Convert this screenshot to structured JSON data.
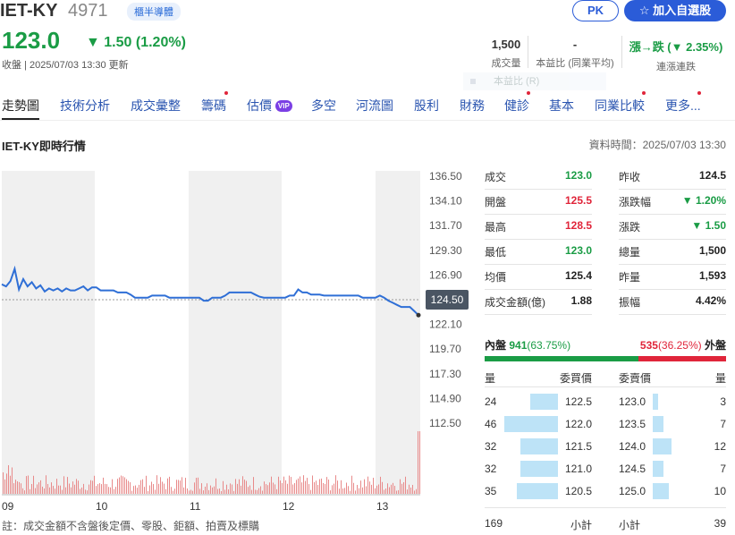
{
  "header": {
    "title": "IET-KY",
    "code": "4971",
    "tag": "櫃半導體",
    "pk_label": "PK",
    "add_label": "☆ 加入自選股"
  },
  "quote": {
    "price": "123.0",
    "change": "▼ 1.50 (1.20%)",
    "updated": "收盤 | 2025/07/03 13:30 更新"
  },
  "stats": {
    "volume_val": "1,500",
    "volume_lbl": "成交量",
    "pe_val": "-",
    "pe_lbl": "本益比 (同業平均)",
    "trend_val": "漲→跌 (▼ 2.35%)",
    "trend_lbl": "連漲連跌",
    "overlay": "本益比 (R)"
  },
  "tabs": [
    "走勢圖",
    "技術分析",
    "成交彙整",
    "籌碼",
    "估價",
    "多空",
    "河流圖",
    "股利",
    "財務",
    "健診",
    "基本",
    "同業比較",
    "更多..."
  ],
  "vip_label": "VIP",
  "section": {
    "title": "IET-KY即時行情",
    "data_time": "資料時間：2025/07/03 13:30"
  },
  "chart_data": {
    "type": "line",
    "yticks": [
      "136.50",
      "134.10",
      "131.70",
      "129.30",
      "126.90",
      "124.50",
      "122.10",
      "119.70",
      "117.30",
      "114.90",
      "112.50"
    ],
    "xticks": [
      "09",
      "10",
      "11",
      "12",
      "13"
    ],
    "current_label": "124.50",
    "ylim": [
      112.5,
      136.5
    ],
    "reference": 124.5,
    "series": [
      {
        "values": [
          126.0,
          125.8,
          126.3,
          127.5,
          125.5,
          126.5,
          125.8,
          126.2,
          125.6,
          125.9,
          125.3,
          125.6,
          125.4,
          125.6,
          125.3,
          125.6,
          125.4,
          125.4,
          125.6,
          125.8,
          125.4,
          125.7,
          125.7,
          125.4,
          125.4,
          125.4,
          125.4,
          125.2,
          125.2,
          125.2,
          125.0,
          124.7,
          124.7,
          124.7,
          124.7,
          124.9,
          124.9,
          124.9,
          124.9,
          124.7,
          124.7,
          124.7,
          124.7,
          124.7,
          124.7,
          124.7,
          124.7,
          124.4,
          124.4,
          124.7,
          124.7,
          124.7,
          124.9,
          125.2,
          125.2,
          125.2,
          125.2,
          125.2,
          125.2,
          125.0,
          124.8,
          124.7,
          124.7,
          124.7,
          124.7,
          124.7,
          124.7,
          124.9,
          124.9,
          125.5,
          125.2,
          125.2,
          125.0,
          125.0,
          125.0,
          124.9,
          124.9,
          124.9,
          124.9,
          124.9,
          124.9,
          124.9,
          124.9,
          124.9,
          124.7,
          124.7,
          124.7,
          124.7,
          124.9,
          124.7,
          124.4,
          124.2,
          124.0,
          123.8,
          123.8,
          123.8,
          123.4,
          123.0
        ]
      }
    ],
    "volume_note": "volume bars"
  },
  "quote_table": {
    "left": [
      {
        "label": "成交",
        "value": "123.0",
        "color": "green"
      },
      {
        "label": "開盤",
        "value": "125.5",
        "color": "red"
      },
      {
        "label": "最高",
        "value": "128.5",
        "color": "red"
      },
      {
        "label": "最低",
        "value": "123.0",
        "color": "green"
      },
      {
        "label": "均價",
        "value": "125.4",
        "color": "dark"
      },
      {
        "label": "成交金額(億)",
        "value": "1.88",
        "color": "dark"
      }
    ],
    "right": [
      {
        "label": "昨收",
        "value": "124.5",
        "color": "dark"
      },
      {
        "label": "漲跌幅",
        "value": "▼ 1.20%",
        "color": "green"
      },
      {
        "label": "漲跌",
        "value": "▼ 1.50",
        "color": "green"
      },
      {
        "label": "總量",
        "value": "1,500",
        "color": "dark"
      },
      {
        "label": "昨量",
        "value": "1,593",
        "color": "dark"
      },
      {
        "label": "振幅",
        "value": "4.42%",
        "color": "dark"
      }
    ]
  },
  "inout": {
    "in_label": "內盤",
    "in_val": "941",
    "in_pct": "(63.75%)",
    "out_val": "535",
    "out_pct": "(36.25%)",
    "out_label": "外盤",
    "in_ratio": 0.6375
  },
  "orderbook": {
    "bid_headers": [
      "量",
      "委買價"
    ],
    "ask_headers": [
      "委賣價",
      "量"
    ],
    "bids": [
      {
        "qty": "24",
        "price": "122.5",
        "fill": 0.52
      },
      {
        "qty": "46",
        "price": "122.0",
        "fill": 1.0
      },
      {
        "qty": "32",
        "price": "121.5",
        "fill": 0.7
      },
      {
        "qty": "32",
        "price": "121.0",
        "fill": 0.7
      },
      {
        "qty": "35",
        "price": "120.5",
        "fill": 0.76
      }
    ],
    "asks": [
      {
        "price": "123.0",
        "qty": "3",
        "fill": 0.07
      },
      {
        "price": "123.5",
        "qty": "7",
        "fill": 0.15
      },
      {
        "price": "124.0",
        "qty": "12",
        "fill": 0.26
      },
      {
        "price": "124.5",
        "qty": "7",
        "fill": 0.15
      },
      {
        "price": "125.0",
        "qty": "10",
        "fill": 0.22
      }
    ],
    "bid_total": "169",
    "bid_total_label": "小計",
    "ask_total_label": "小計",
    "ask_total": "39"
  },
  "footnote": "註：成交金額不含盤後定價、零股、鉅額、拍賣及標購"
}
